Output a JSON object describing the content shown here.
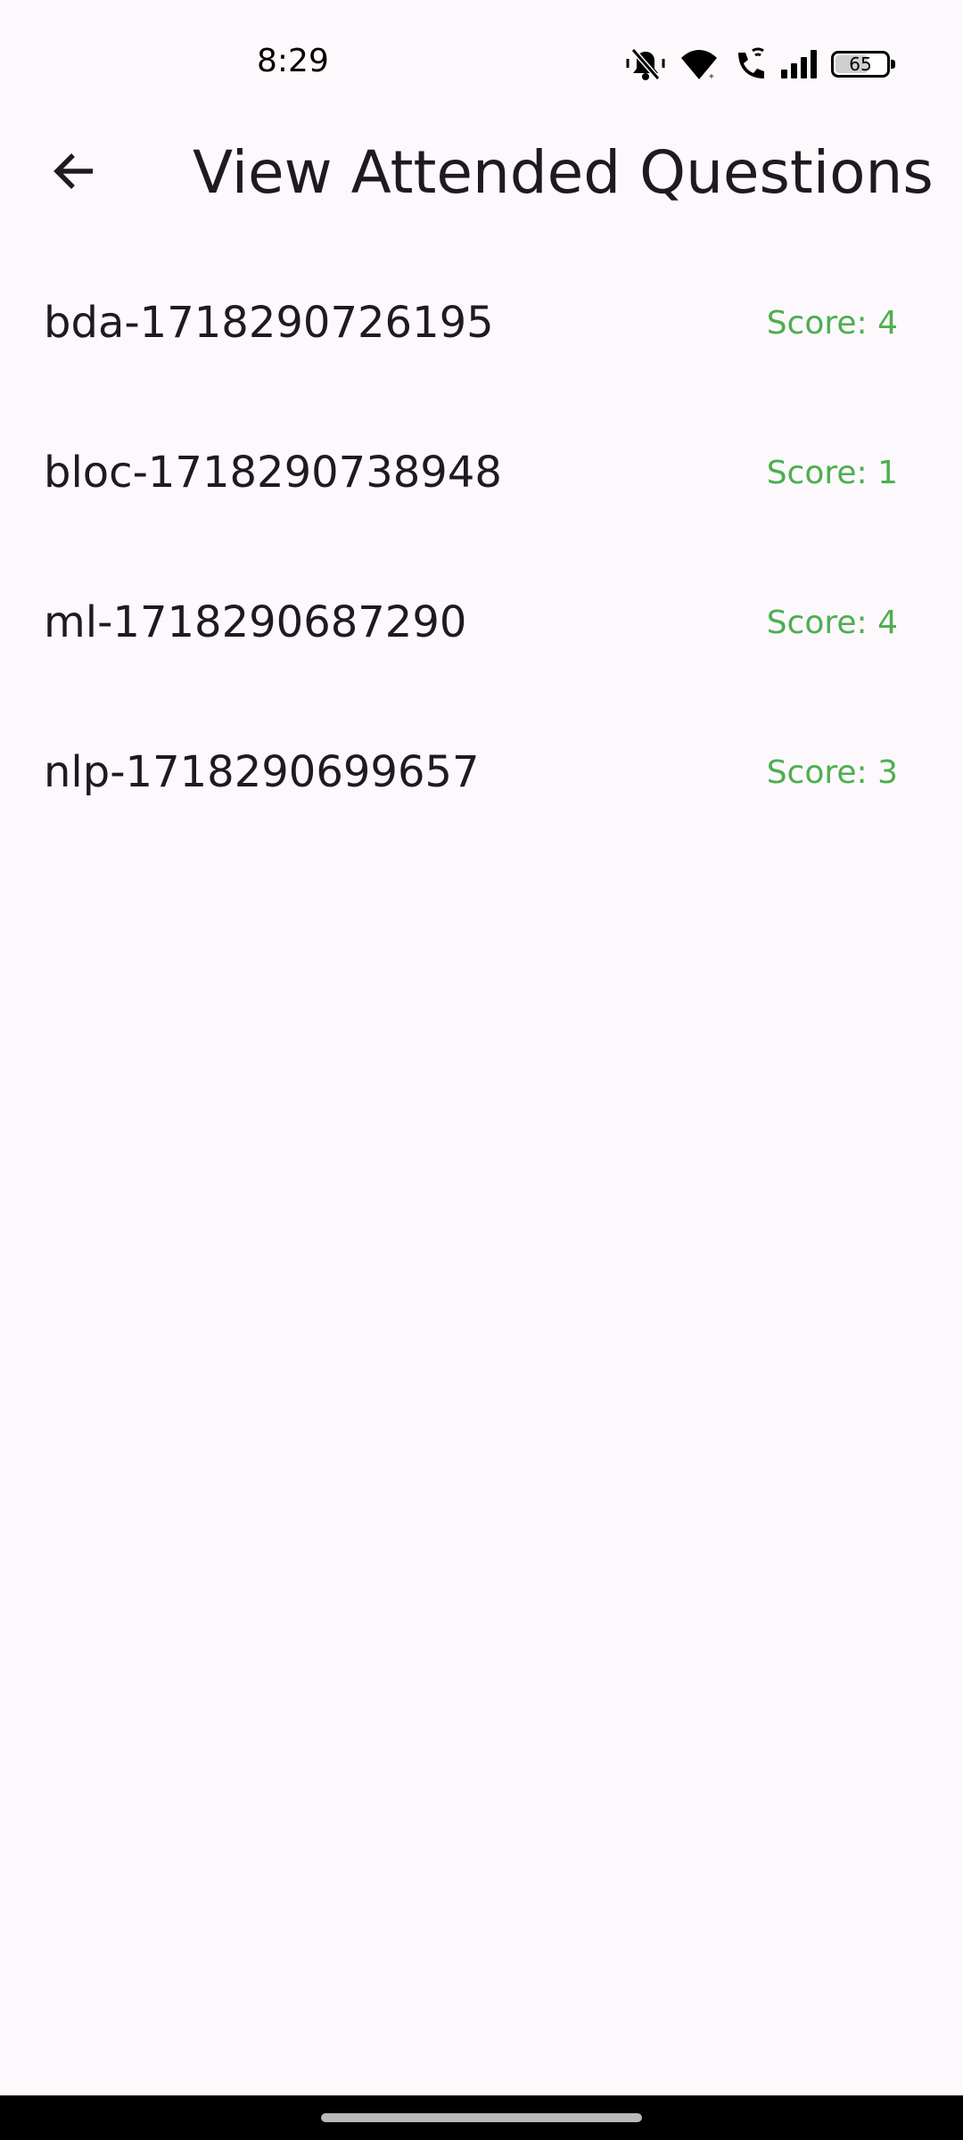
{
  "status_bar": {
    "time": "8:29",
    "battery": "65",
    "battery_level": 0.65,
    "icons": [
      "mute-icon",
      "wifi-icon",
      "wifi-call-icon",
      "signal-icon",
      "battery-icon"
    ]
  },
  "header": {
    "title": "View Attended Questions",
    "back_icon": "arrow-back-icon"
  },
  "colors": {
    "background": "#fdf8fb",
    "text": "#1d1b20",
    "score": "#4caf50"
  },
  "attempts": [
    {
      "title": "bda-1718290726195",
      "score": "Score: 4"
    },
    {
      "title": "bloc-1718290738948",
      "score": "Score: 1"
    },
    {
      "title": "ml-1718290687290",
      "score": "Score: 4"
    },
    {
      "title": "nlp-1718290699657",
      "score": "Score: 3"
    }
  ]
}
